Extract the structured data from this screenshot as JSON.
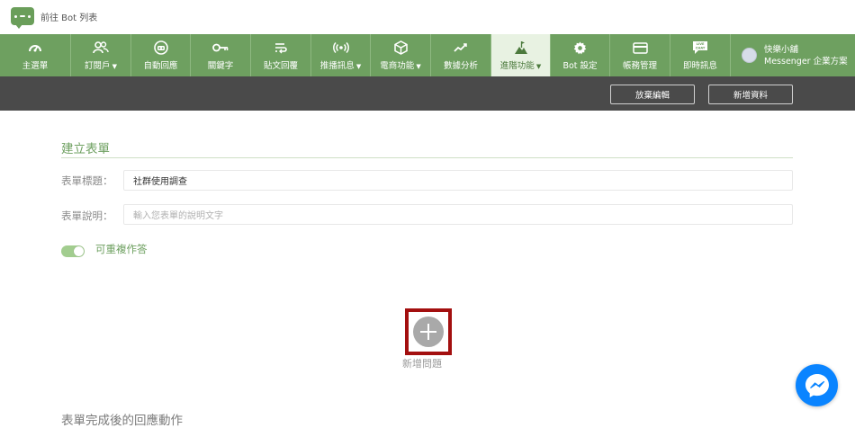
{
  "top": {
    "back_label": "前往 Bot 列表"
  },
  "nav": {
    "items": [
      {
        "label": "主選單",
        "icon": "gauge-icon",
        "caret": ""
      },
      {
        "label": "訂閱戶",
        "icon": "users-icon",
        "caret": "▼"
      },
      {
        "label": "自動回應",
        "icon": "bot-face-icon",
        "caret": ""
      },
      {
        "label": "關鍵字",
        "icon": "key-icon",
        "caret": ""
      },
      {
        "label": "貼文回覆",
        "icon": "reply-icon",
        "caret": ""
      },
      {
        "label": "推播訊息",
        "icon": "broadcast-icon",
        "caret": "▼"
      },
      {
        "label": "電商功能",
        "icon": "package-icon",
        "caret": "▼"
      },
      {
        "label": "數據分析",
        "icon": "trend-icon",
        "caret": ""
      },
      {
        "label": "進階功能",
        "icon": "mountain-flag-icon",
        "caret": "▼",
        "active": true
      },
      {
        "label": "Bot 設定",
        "icon": "gear-icon",
        "caret": ""
      },
      {
        "label": "帳務管理",
        "icon": "credit-card-icon",
        "caret": ""
      },
      {
        "label": "即時訊息",
        "icon": "live-chat-icon",
        "caret": ""
      }
    ],
    "account": {
      "name": "快樂小舖",
      "plan": "Messenger 企業方案"
    }
  },
  "toolbar": {
    "discard_label": "放棄編輯",
    "add_data_label": "新增資料"
  },
  "form": {
    "section_title": "建立表單",
    "title_label": "表單標題：",
    "title_value": "社群使用調查",
    "desc_label": "表單說明：",
    "desc_placeholder": "輸入您表單的說明文字",
    "repeat_label": "可重複作答",
    "repeat_enabled": true,
    "add_question_label": "新增問題",
    "after_submit_title": "表單完成後的回應動作"
  },
  "colors": {
    "nav_green": "#6ea060",
    "toolbar_dark": "#4a4a4a",
    "highlight_red": "#a30f0f",
    "messenger_blue": "#0a84ff"
  }
}
